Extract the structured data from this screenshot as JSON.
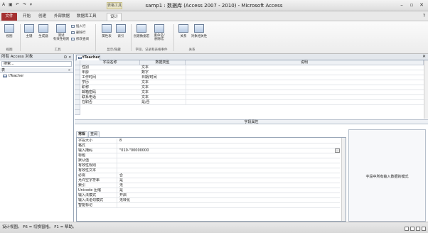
{
  "window": {
    "title": "samp1 : 数据库 (Access 2007 - 2010) - Microsoft Access",
    "context_group": "表格工具"
  },
  "tabs": [
    "文件",
    "开始",
    "创建",
    "外部数据",
    "数据库工具",
    "设计"
  ],
  "ribbon": {
    "views": {
      "view_label": "视图",
      "group": "视图"
    },
    "tools": {
      "primary_key": "主键",
      "builder": "生成器",
      "test_rules": "测试\n有效性规则",
      "insert_rows": "插入行",
      "delete_rows": "删除行",
      "modify_lookups": "修改查阅",
      "group": "工具"
    },
    "show_hide": {
      "property_sheet": "属性表",
      "indexes": "索引",
      "group": "显示/隐藏"
    },
    "field_events": {
      "create_macros": "创建数据宏",
      "rename_delete": "重命名/\n删除宏",
      "group": "字段、记录和表格事件"
    },
    "relationships": {
      "relationships": "关系",
      "dependencies": "对象相关性",
      "group": "关系"
    }
  },
  "nav": {
    "header": "所有 Access 对象",
    "search_placeholder": "搜索...",
    "group": "表",
    "items": [
      "tTeacher"
    ]
  },
  "document": {
    "tab": "tTeacher",
    "columns": [
      "字段名称",
      "数据类型",
      "说明"
    ],
    "rows": [
      {
        "name": "性别",
        "type": "文本"
      },
      {
        "name": "年龄",
        "type": "数字"
      },
      {
        "name": "工作时间",
        "type": "日期/时间"
      },
      {
        "name": "学历",
        "type": "文本"
      },
      {
        "name": "职称",
        "type": "文本"
      },
      {
        "name": "邮箱密码",
        "type": "文本"
      },
      {
        "name": "联系电话",
        "type": "文本"
      },
      {
        "name": "在职否",
        "type": "是/否"
      }
    ]
  },
  "field_properties": {
    "title": "字段属性",
    "tabs": [
      "常规",
      "查阅"
    ],
    "rows": [
      {
        "name": "字段大小",
        "value": "8"
      },
      {
        "name": "格式",
        "value": ""
      },
      {
        "name": "输入掩码",
        "value": "\"010-\"00000000"
      },
      {
        "name": "标题",
        "value": ""
      },
      {
        "name": "默认值",
        "value": ""
      },
      {
        "name": "有效性规则",
        "value": ""
      },
      {
        "name": "有效性文本",
        "value": ""
      },
      {
        "name": "必需",
        "value": "否"
      },
      {
        "name": "允许空字符串",
        "value": "是"
      },
      {
        "name": "索引",
        "value": "无"
      },
      {
        "name": "Unicode 压缩",
        "value": "是"
      },
      {
        "name": "输入法模式",
        "value": "开启"
      },
      {
        "name": "输入法语句模式",
        "value": "无转化"
      },
      {
        "name": "智能标记",
        "value": ""
      }
    ],
    "help_text": "字段中所有输入数据的模式"
  },
  "status": {
    "text": "设计视图。 F6 = 切换窗格。 F1 = 帮助。"
  }
}
